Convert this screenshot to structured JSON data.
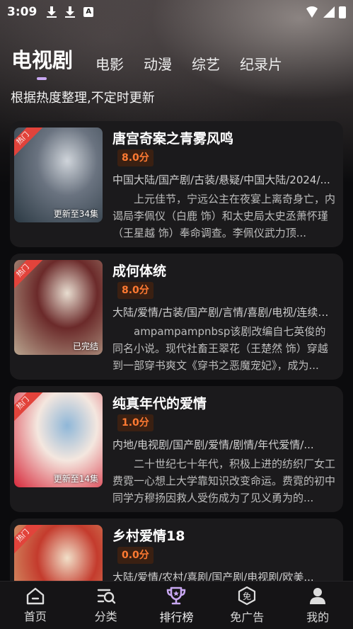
{
  "status": {
    "time": "3:09",
    "a_badge": "A"
  },
  "tabs": [
    {
      "label": "电视剧",
      "active": true
    },
    {
      "label": "电影"
    },
    {
      "label": "动漫"
    },
    {
      "label": "综艺"
    },
    {
      "label": "纪录片"
    }
  ],
  "subtitle": "根据热度整理,不定时更新",
  "items": [
    {
      "badge": "热门",
      "title": "唐宫奇案之青雾风鸣",
      "score": "8.0分",
      "episodes": "更新至34集",
      "tags": "中国大陆/国产剧/古装/悬疑/中国大陆/2024/...",
      "description": "上元佳节，宁远公主在夜宴上离奇身亡，内谒局李佩仪（白鹿 饰）和太史局太史丞萧怀瑾（王星越 饰）奉命调查。李佩仪武力顶...",
      "colors": [
        "#2c3a44",
        "#6a7380",
        "#cfd4da"
      ]
    },
    {
      "badge": "热门",
      "title": "成何体统",
      "score": "8.0分",
      "episodes": "已完结",
      "tags": "大陆/爱情/古装/国产剧/言情/喜剧/电视/连续剧...",
      "description": "ampampampnbsp该剧改编自七英俊的同名小说。现代社畜王翠花（王楚然 饰）穿越到一部穿书爽文《穿书之恶魔宠妃》，成为...",
      "colors": [
        "#b9a58f",
        "#6b2a2a",
        "#e8ddd0"
      ]
    },
    {
      "badge": "热门",
      "title": "纯真年代的爱情",
      "score": "1.0分",
      "episodes": "更新至14集",
      "tags": "内地/电视剧/国产剧/爱情/剧情/年代爱情/...",
      "description": "二十世纪七十年代，积极上进的纺织厂女工费霓一心想上大学靠知识改变命运。费霓的初中同学方穆扬因救人受伤成为了见义勇为的...",
      "colors": [
        "#d7283a",
        "#f4e7df",
        "#8fb7d8"
      ]
    },
    {
      "badge": "热门",
      "title": "乡村爱情18",
      "score": "0.0分",
      "episodes": "",
      "tags": "大陆/爱情/农村/喜剧/国产剧/电视剧/欧美...",
      "description": "",
      "colors": [
        "#d9b07a",
        "#c43b2d",
        "#f1dfc8"
      ]
    }
  ],
  "nav": [
    {
      "label": "首页",
      "icon": "home-icon"
    },
    {
      "label": "分类",
      "icon": "category-icon"
    },
    {
      "label": "排行榜",
      "icon": "trophy-icon",
      "active": true
    },
    {
      "label": "免广告",
      "icon": "ad-free-icon"
    },
    {
      "label": "我的",
      "icon": "profile-icon"
    }
  ],
  "accent_color": "#c9a8f2",
  "score_color": "#ff7a32"
}
